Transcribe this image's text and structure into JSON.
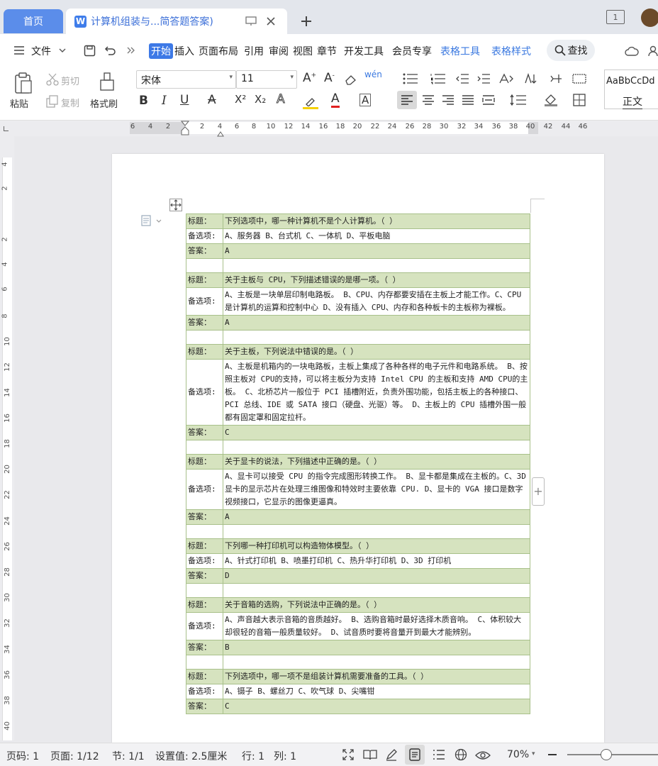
{
  "tabs": {
    "home": "首页",
    "doc_title": "计算机组装与...简答题答案)",
    "doc_icon": "W",
    "window_count": "1"
  },
  "menu": {
    "file": "文件",
    "items": [
      "开始",
      "插入",
      "页面布局",
      "引用",
      "审阅",
      "视图",
      "章节",
      "开发工具",
      "会员专享",
      "表格工具",
      "表格样式"
    ],
    "search": "查找"
  },
  "ribbon": {
    "paste": "粘贴",
    "cut": "剪切",
    "copy": "复制",
    "format_painter": "格式刷",
    "font": "宋体",
    "size": "11",
    "style_preview": "AaBbCcDd",
    "style_name": "正文"
  },
  "ruler": {
    "h": [
      "6",
      "4",
      "2",
      "2",
      "4",
      "6",
      "8",
      "10",
      "12",
      "14",
      "16",
      "18",
      "20",
      "22",
      "24",
      "26",
      "28",
      "30",
      "32",
      "34",
      "36",
      "38",
      "40",
      "42",
      "44",
      "46"
    ],
    "v": [
      "4",
      "2",
      "2",
      "4",
      "6",
      "8",
      "10",
      "12",
      "14",
      "16",
      "18",
      "20",
      "22",
      "24",
      "26",
      "28",
      "30",
      "32",
      "34",
      "36",
      "38",
      "40"
    ]
  },
  "questions": [
    {
      "title_label": "标题：",
      "title": "下列选项中，哪一种计算机不是个人计算机。（ ）",
      "opt_label": "备选项:",
      "options": "A、服务器 B、台式机 C、一体机 D、平板电脑",
      "ans_label": "答案：",
      "answer": "A"
    },
    {
      "title_label": "标题：",
      "title": "关于主板与 CPU，下列描述错误的是哪一项。（ ）",
      "opt_label": "备选项:",
      "options": "A、主板是一块单层印制电路板。 B、CPU、内存都要安插在主板上才能工作。C、CPU 是计算机的运算和控制中心 D、没有插入 CPU、内存和各种板卡的主板称为裸板。",
      "ans_label": "答案：",
      "answer": "A"
    },
    {
      "title_label": "标题：",
      "title": "关于主板，下列说法中错误的是。（ ）",
      "opt_label": "备选项:",
      "options": "A、主板是机箱内的一块电路板，主板上集成了各种各样的电子元件和电路系统。 B、按照主板对 CPU的支持，可以将主板分为支持 Intel CPU 的主板和支持 AMD CPU的主板。 C、北桥芯片一般位于 PCI 插槽附近，负责外围功能，包括主板上的各种接口、PCI 总线、IDE 或 SATA 接口（硬盘、光驱）等。 D、主板上的 CPU 插槽外围一般都有固定罩和固定拉杆。",
      "ans_label": "答案：",
      "answer": "C"
    },
    {
      "title_label": "标题：",
      "title": "关于显卡的说法，下列描述中正确的是。（ ）",
      "opt_label": "备选项:",
      "options": "A、显卡可以接受 CPU 的指令完成图形转换工作。 B、显卡都是集成在主板的。C、3D 显卡的显示芯片在处理三维图像和特效时主要依靠 CPU. D、显卡的 VGA 接口是数字视频接口，它显示的图像更逼真。",
      "ans_label": "答案：",
      "answer": "A"
    },
    {
      "title_label": "标题：",
      "title": "下列哪一种打印机可以构造物体模型。（ ）",
      "opt_label": "备选项:",
      "options": "A、针式打印机 B、喷墨打印机 C、热升华打印机 D、3D 打印机",
      "ans_label": "答案：",
      "answer": "D"
    },
    {
      "title_label": "标题：",
      "title": "关于音箱的选购，下列说法中正确的是。（ ）",
      "opt_label": "备选项:",
      "options": "A、声音越大表示音箱的音质越好。 B、选购音箱时最好选择木质音响。 C、体积较大却很轻的音箱一般质量较好。 D、试音质时要将音量开到最大才能辨别。",
      "ans_label": "答案：",
      "answer": "B"
    },
    {
      "title_label": "标题：",
      "title": "下列选项中，哪一项不是组装计算机需要准备的工具。（ ）",
      "opt_label": "备选项:",
      "options": "A、镊子 B、螺丝刀 C、吹气球 D、尖嘴钳",
      "ans_label": "答案：",
      "answer": "C"
    }
  ],
  "status": {
    "page_no": "页码: 1",
    "pages": "页面: 1/12",
    "section": "节: 1/1",
    "setting": "设置值: 2.5厘米",
    "row": "行: 1",
    "col": "列: 1",
    "zoom": "70%"
  }
}
